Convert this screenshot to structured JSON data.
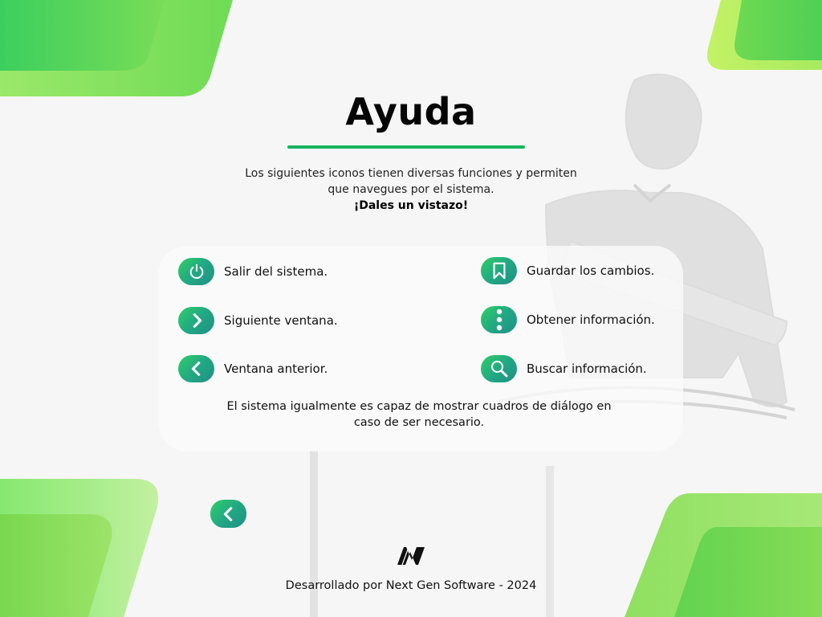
{
  "page": {
    "title": "Ayuda",
    "intro_line1": "Los siguientes iconos tienen diversas funciones y permiten",
    "intro_line2": "que navegues por el sistema.",
    "intro_highlight": "¡Dales un vistazo!"
  },
  "help_items": {
    "exit": {
      "icon": "power-icon",
      "label": "Salir del sistema."
    },
    "next": {
      "icon": "chevron-right-icon",
      "label": "Siguiente ventana."
    },
    "previous": {
      "icon": "chevron-left-icon",
      "label": "Ventana anterior."
    },
    "save": {
      "icon": "bookmark-icon",
      "label": "Guardar los cambios."
    },
    "info": {
      "icon": "vertical-dots-icon",
      "label": "Obtener información."
    },
    "search": {
      "icon": "search-icon",
      "label": "Buscar información."
    }
  },
  "note": {
    "line1": "El sistema igualmente es capaz de mostrar cuadros de diálogo en",
    "line2": "caso de ser necesario."
  },
  "navigation": {
    "back_icon": "chevron-left-icon"
  },
  "footer": {
    "logo_icon": "next-gen-logo-icon",
    "text": "Desarrollado por Next Gen Software - 2024"
  },
  "colors": {
    "accent_green": "#19b35e",
    "button_gradient_start": "#2fcf66",
    "button_gradient_end": "#1f8f86",
    "background": "#f6f6f6"
  }
}
